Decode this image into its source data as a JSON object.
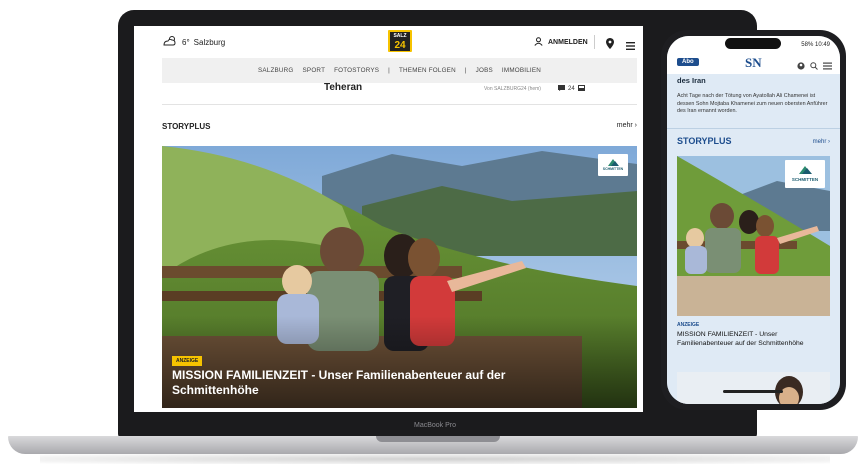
{
  "laptop": {
    "macbook_label": "MacBook Pro",
    "header": {
      "weather_temp": "6°",
      "weather_city": "Salzburg",
      "logo_top": "SALZ BURG",
      "logo_bottom": "24",
      "login_label": "ANMELDEN"
    },
    "nav": {
      "items": [
        "SALZBURG",
        "SPORT",
        "FOTOSTORYS",
        "|",
        "THEMEN FOLGEN",
        "|",
        "JOBS",
        "IMMOBILIEN"
      ]
    },
    "teaser": {
      "title": "Teheran",
      "meta": "Von SALZBURG24 (hem)",
      "comment_count": "24"
    },
    "storyplus": {
      "label": "STORYPLUS",
      "more": "mehr ›",
      "badge": "ANZEIGE",
      "headline": "MISSION FAMILIENZEIT - Unser Familienabenteuer auf der Schmittenhöhe",
      "sponsor": "SCHMITTEN"
    }
  },
  "phone": {
    "status_battery": "58%",
    "status_time": "10:49",
    "abo_label": "Abo",
    "logo": "SN",
    "top_snippet": "des Iran",
    "top_text": "Acht Tage nach der Tötung von Ayatollah Ali Chamenei ist dessen Sohn Mojtaba Khamenei zum neuen obersten Anführer des Iran ernannt worden.",
    "storyplus_label": "STORYPLUS",
    "more": "mehr ›",
    "anzeige": "ANZEIGE",
    "headline": "MISSION FAMILIENZEIT - Unser Familienabenteuer auf der Schmittenhöhe",
    "sponsor": "SCHMITTEN"
  },
  "colors": {
    "brand_yellow": "#f6c300",
    "sn_blue": "#1d4d8d"
  }
}
